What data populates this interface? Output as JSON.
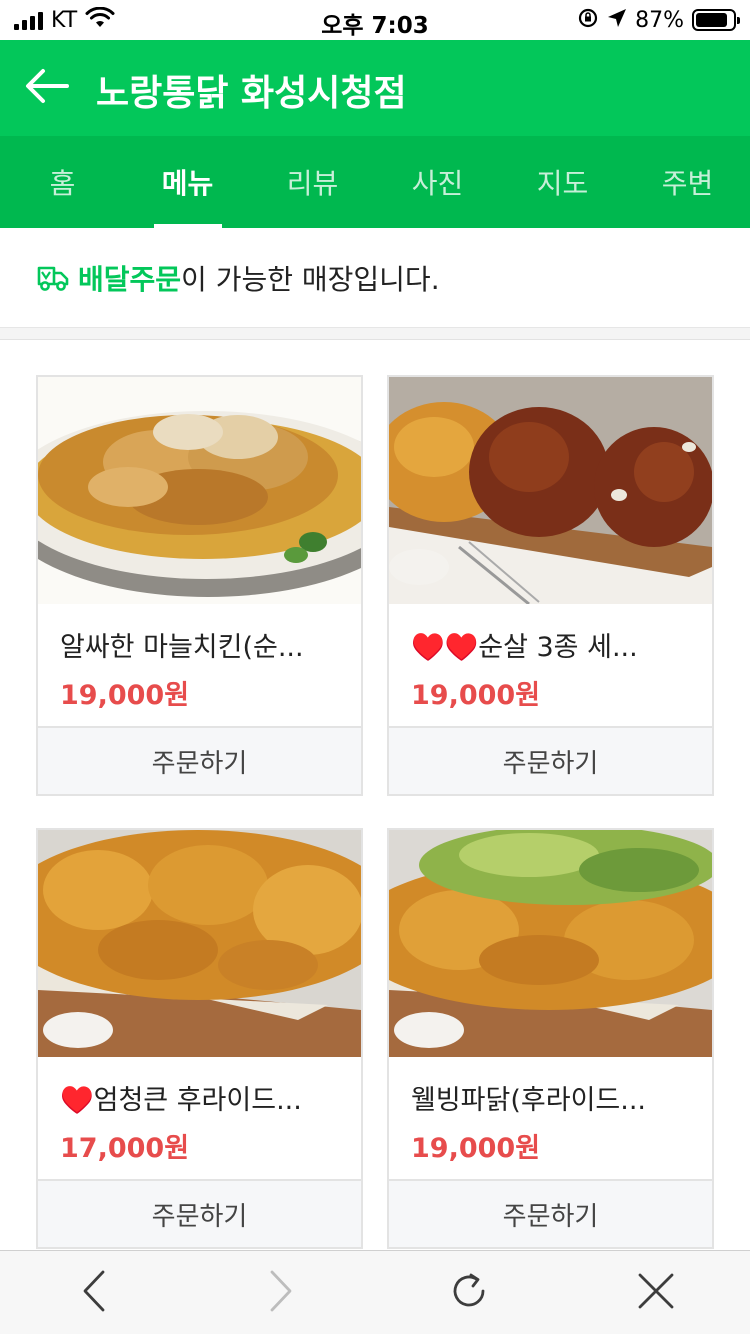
{
  "status_bar": {
    "carrier": "KT",
    "time": "오후 7:03",
    "battery": "87%",
    "battery_level": 0.87
  },
  "header": {
    "back_icon": "back-arrow-icon",
    "title": "노랑통닭 화성시청점"
  },
  "tabs": [
    {
      "label": "홈",
      "active": false
    },
    {
      "label": "메뉴",
      "active": true
    },
    {
      "label": "리뷰",
      "active": false
    },
    {
      "label": "사진",
      "active": false
    },
    {
      "label": "지도",
      "active": false
    },
    {
      "label": "주변",
      "active": false
    }
  ],
  "notice": {
    "icon": "delivery-truck-icon",
    "highlight": "배달주문",
    "text": "이 가능한 매장입니다."
  },
  "menu": {
    "items": [
      {
        "name": "알싸한 마늘치킨(순...",
        "price": "19,000원",
        "button": "주문하기"
      },
      {
        "name": "♥️♥️순살 3종 세...",
        "price": "19,000원",
        "button": "주문하기"
      },
      {
        "name": "♥️엄청큰 후라이드...",
        "price": "17,000원",
        "button": "주문하기"
      },
      {
        "name": "웰빙파닭(후라이드...",
        "price": "19,000원",
        "button": "주문하기"
      }
    ]
  },
  "toolbar": {
    "icons": [
      "back-chevron-icon",
      "forward-chevron-icon",
      "reload-icon",
      "close-icon"
    ]
  },
  "colors": {
    "brand_green": "#03c75a",
    "tab_green": "#00b84f",
    "price_red": "#e74c4c"
  }
}
